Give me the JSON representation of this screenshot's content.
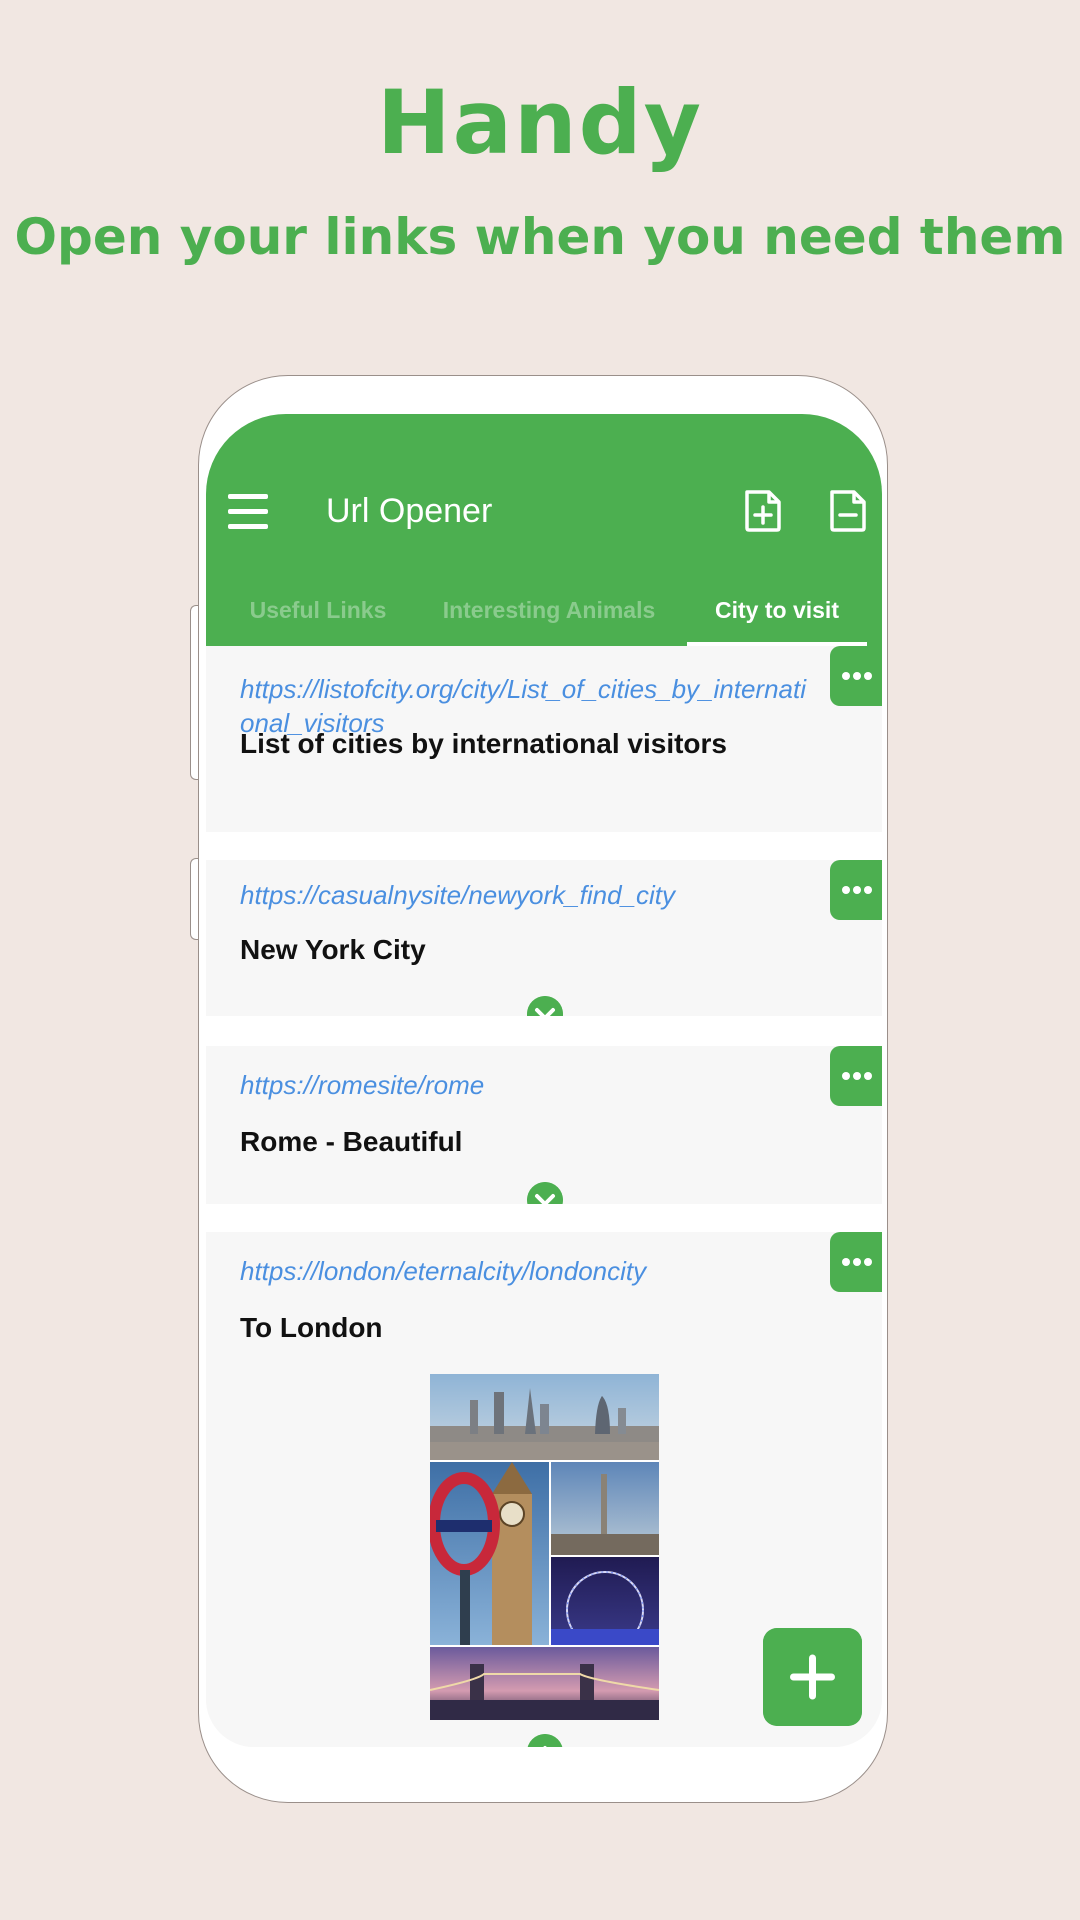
{
  "promo": {
    "title": "Handy",
    "subtitle": "Open your links when you need them"
  },
  "appbar": {
    "title": "Url Opener",
    "icons": [
      "menu-icon",
      "add-file-icon",
      "remove-file-icon"
    ]
  },
  "tabs": [
    {
      "label": "Useful Links",
      "active": false
    },
    {
      "label": "Interesting Animals",
      "active": false
    },
    {
      "label": "City to visit",
      "active": true
    }
  ],
  "cards": [
    {
      "url": "https://listofcity.org/city/List_of_cities_by_international_visitors",
      "title": "List of cities by international visitors"
    },
    {
      "url": "https://casualnysite/newyork_find_city",
      "title": "New York City"
    },
    {
      "url": "https://romesite/rome",
      "title": "Rome - Beautiful"
    },
    {
      "url": "https://london/eternalcity/londoncity",
      "title": "To London"
    }
  ],
  "colors": {
    "accent": "#4CAF50",
    "link": "#4A8FE0",
    "background": "#F1E7E2",
    "card": "#F7F7F7"
  }
}
